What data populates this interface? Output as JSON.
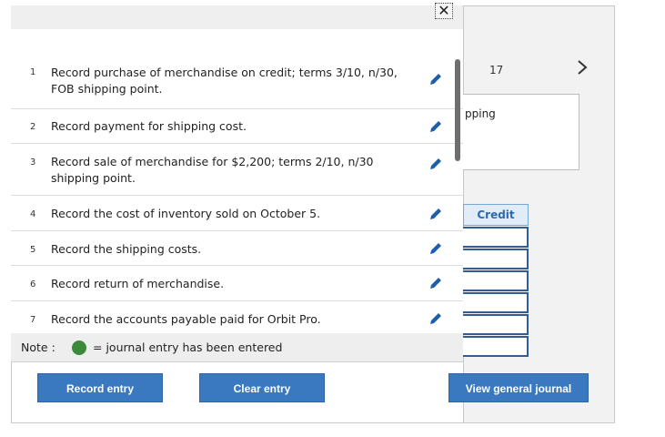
{
  "dialog": {
    "close_symbol": "✕"
  },
  "journal": {
    "page_number": "17",
    "next_symbol": "›",
    "description_fragment": "pping",
    "credit_header": "Credit"
  },
  "entries": [
    {
      "num": "1",
      "text": "Record purchase of merchandise on credit; terms 3/10, n/30, FOB shipping point."
    },
    {
      "num": "2",
      "text": "Record payment for shipping cost."
    },
    {
      "num": "3",
      "text": "Record sale of merchandise for $2,200; terms 2/10, n/30 shipping point."
    },
    {
      "num": "4",
      "text": "Record the cost of inventory sold on October 5."
    },
    {
      "num": "5",
      "text": "Record the shipping costs."
    },
    {
      "num": "6",
      "text": "Record return of merchandise."
    },
    {
      "num": "7",
      "text": "Record the accounts payable paid for Orbit Pro."
    }
  ],
  "note": {
    "label": "Note :",
    "text": "= journal entry has been entered",
    "dot_color": "#3b8a3a"
  },
  "buttons": {
    "record_entry": "Record entry",
    "clear_entry": "Clear entry",
    "view_general_journal": "View general journal"
  },
  "colors": {
    "button_blue": "#3a79bf",
    "credit_border": "#2e5e95",
    "pencil_blue": "#1f5fa8"
  }
}
